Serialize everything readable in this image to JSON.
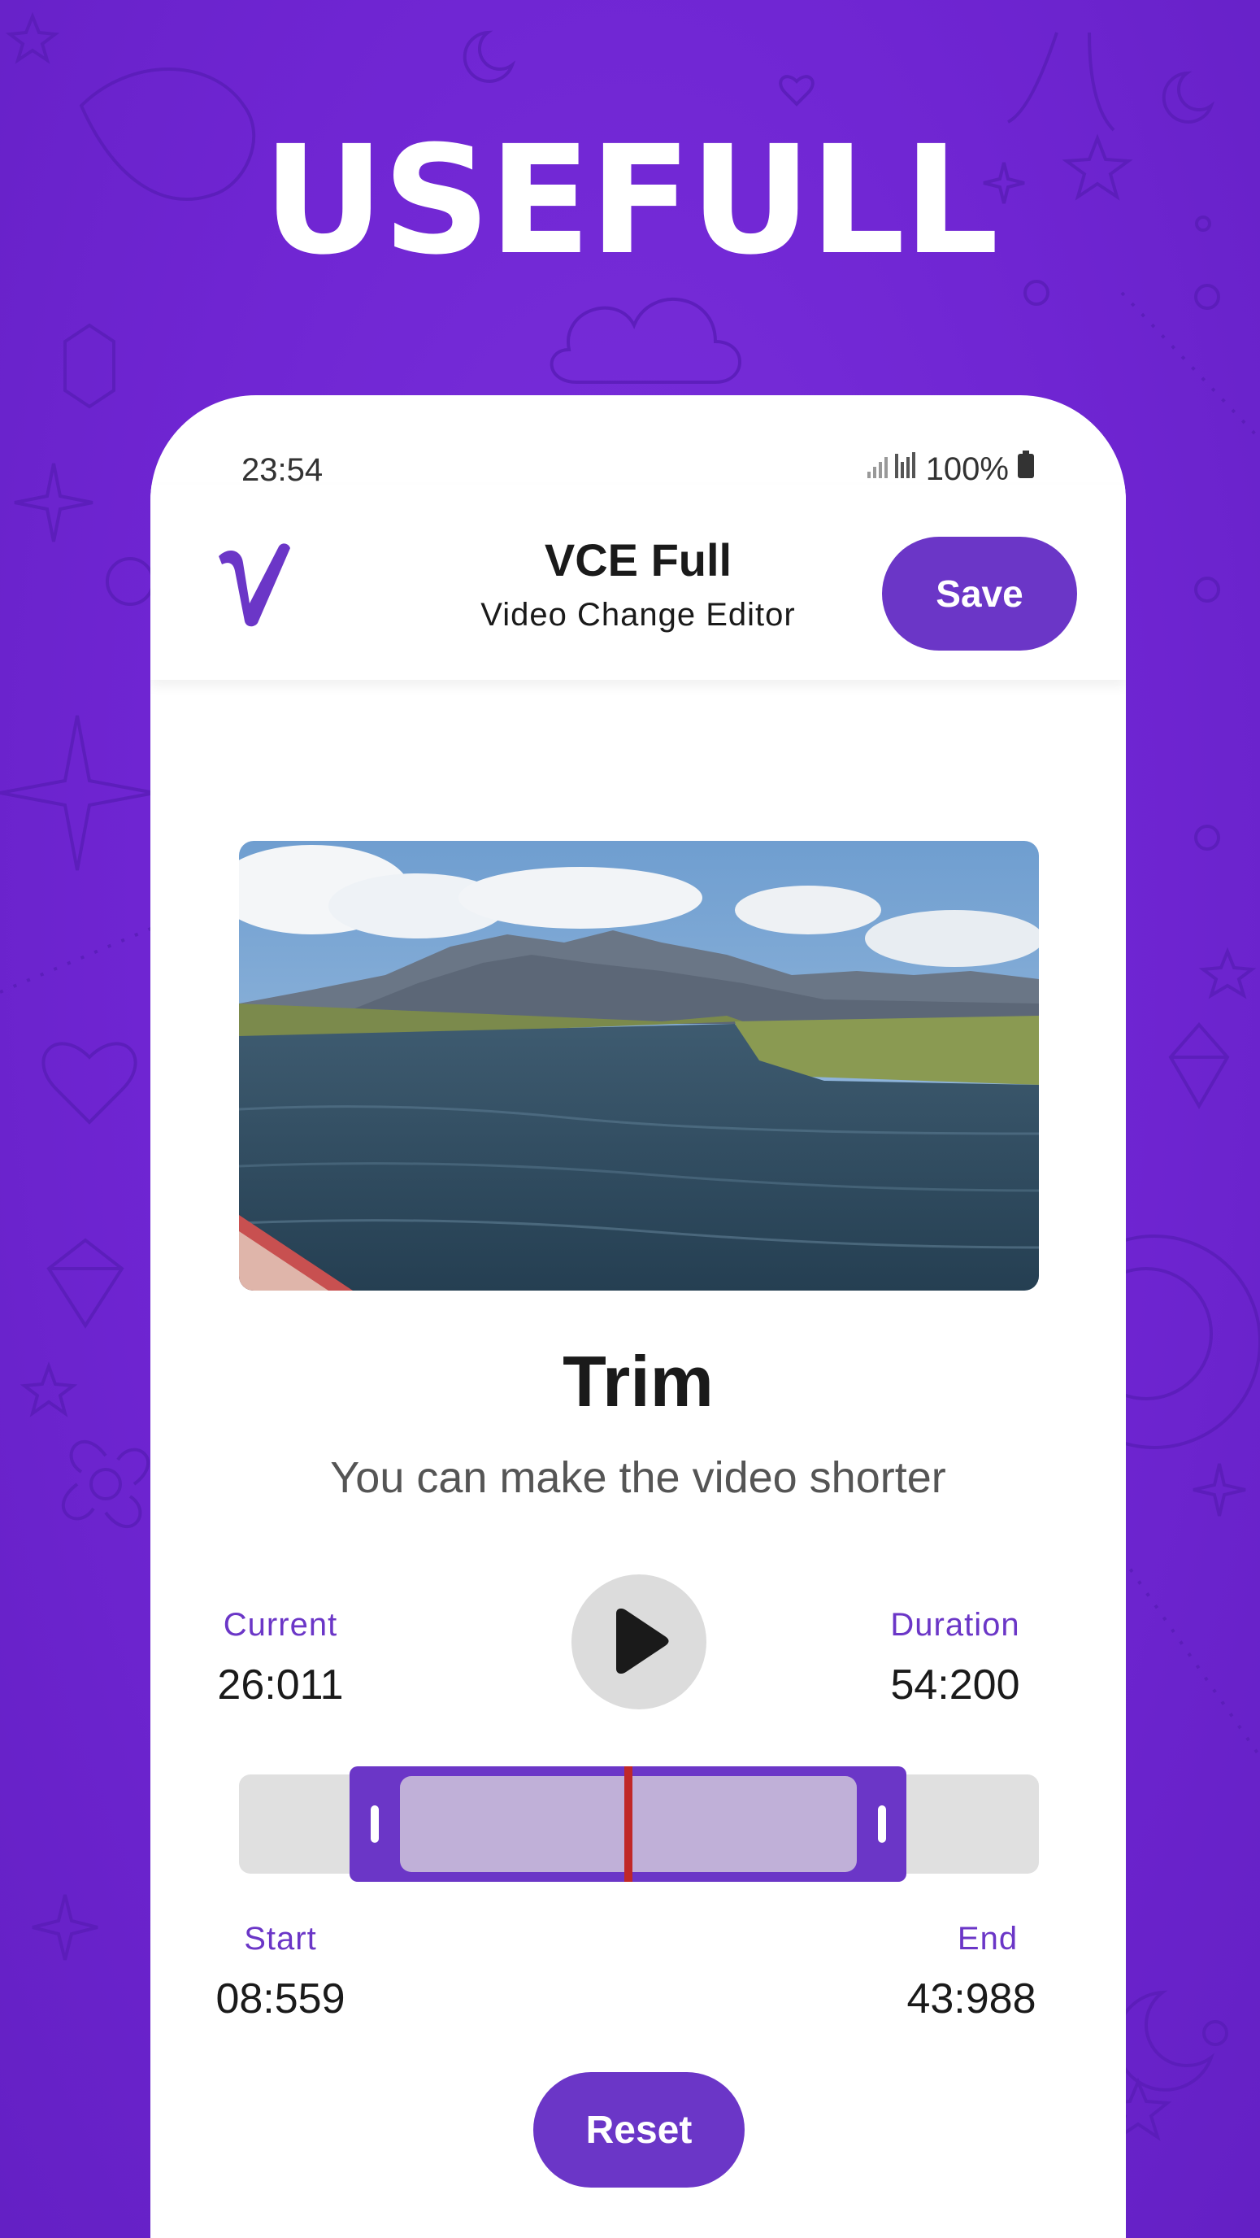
{
  "promo": {
    "headline": "USEFULL"
  },
  "status_bar": {
    "time": "23:54",
    "battery": "100%"
  },
  "app_bar": {
    "logo_letter": "V",
    "title": "VCE Full",
    "subtitle": "Video Change Editor",
    "save_label": "Save"
  },
  "video": {
    "description": "lake-mountains-preview"
  },
  "trim": {
    "title": "Trim",
    "description": "You can make the video shorter",
    "current_label": "Current",
    "current_value": "26:011",
    "duration_label": "Duration",
    "duration_value": "54:200",
    "start_label": "Start",
    "start_value": "08:559",
    "end_label": "End",
    "end_value": "43:988",
    "reset_label": "Reset"
  },
  "colors": {
    "background": "#7428d8",
    "accent": "#6b36c7",
    "selection_fill": "#c0b0d8",
    "playhead": "#c02828",
    "track": "#e0e0e0"
  },
  "icons": [
    "signal-icon",
    "battery-icon",
    "play-icon",
    "trim-handle-icon"
  ]
}
